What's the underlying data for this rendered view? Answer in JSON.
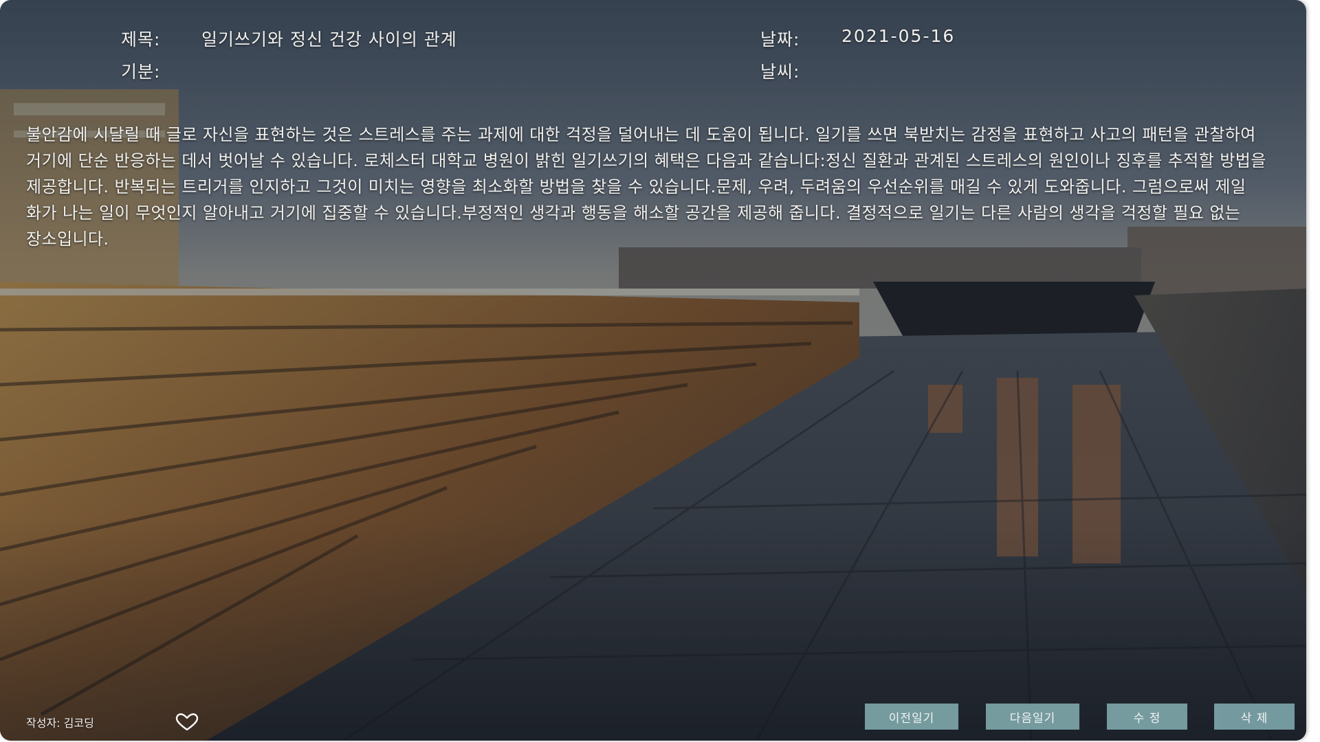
{
  "meta": {
    "title_label": "제목:",
    "title_value": "일기쓰기와 정신 건강 사이의 관계",
    "date_label": "날짜:",
    "date_value": "2021-05-16",
    "mood_label": "기분:",
    "mood_value": "",
    "weather_label": "날씨:",
    "weather_value": ""
  },
  "body": {
    "text": "불안감에 시달릴 때 글로 자신을 표현하는 것은 스트레스를 주는 과제에 대한 걱정을 덜어내는 데 도움이 됩니다. 일기를 쓰면 북받치는 감정을 표현하고 사고의 패턴을 관찰하여 거기에 단순 반응하는 데서 벗어날 수 있습니다. 로체스터 대학교 병원이 밝힌 일기쓰기의 혜택은 다음과 같습니다:정신 질환과 관계된 스트레스의 원인이나 징후를 추적할 방법을 제공합니다. 반복되는 트리거를 인지하고 그것이 미치는 영향을 최소화할 방법을 찾을 수 있습니다.문제, 우려, 두려움의 우선순위를 매길 수 있게 도와줍니다. 그럼으로써 제일 화가 나는 일이 무엇인지 알아내고 거기에 집중할 수 있습니다.부정적인 생각과 행동을 해소할 공간을 제공해 줍니다. 결정적으로 일기는 다른 사람의 생각을 걱정할 필요 없는 장소입니다."
  },
  "footer": {
    "author": "작성자: 김코딩",
    "like_icon": "heart-outline-icon",
    "prev_label": "이전일기",
    "next_label": "다음일기",
    "edit_label": "수 정",
    "delete_label": "삭 제"
  },
  "colors": {
    "button_bg": "#7aa2a6",
    "text": "#f1f1ee"
  }
}
